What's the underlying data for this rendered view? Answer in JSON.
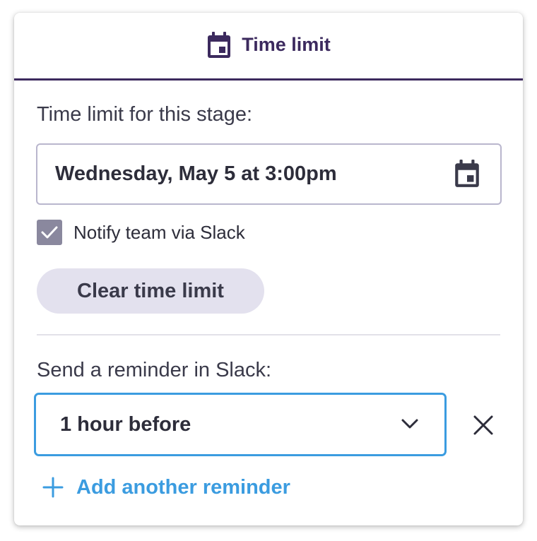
{
  "header": {
    "title": "Time limit",
    "icon": "calendar-icon",
    "accent_color": "#3c2a5e"
  },
  "time_limit": {
    "label": "Time limit for this stage:",
    "value": "Wednesday, May 5 at 3:00pm",
    "icon": "calendar-icon"
  },
  "notify": {
    "checked": true,
    "label": "Notify team via Slack"
  },
  "clear_button": {
    "label": "Clear time limit"
  },
  "reminder": {
    "label": "Send a reminder in Slack:",
    "selected": "1 hour before",
    "focus_color": "#3b9ce0"
  },
  "add_reminder": {
    "label": "Add another reminder",
    "icon": "plus-icon"
  }
}
